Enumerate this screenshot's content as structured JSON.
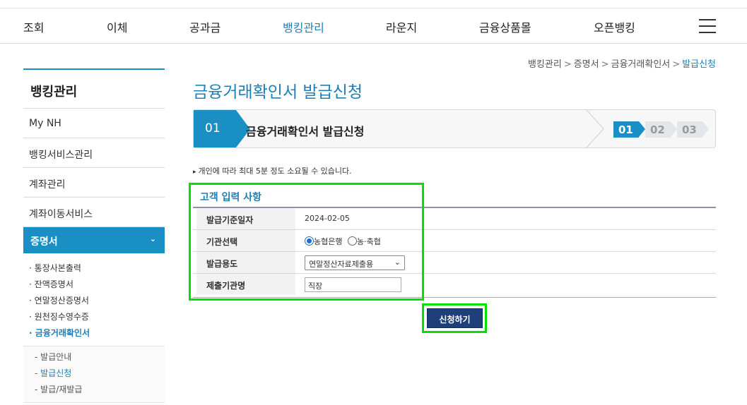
{
  "topnav": {
    "items": [
      "조회",
      "이체",
      "공과금",
      "뱅킹관리",
      "라운지",
      "금융상품몰",
      "오픈뱅킹"
    ],
    "active_index": 3,
    "menu_icon": "hamburger-icon"
  },
  "breadcrumb": [
    "뱅킹관리",
    "증명서",
    "금융거래확인서",
    "발급신청"
  ],
  "breadcrumb_separator": ">",
  "sidebar": {
    "title": "뱅킹관리",
    "menus": [
      "My NH",
      "뱅킹서비스관리",
      "계좌관리",
      "계좌이동서비스"
    ],
    "active_menu": "증명서",
    "sub_items": [
      "통장사본출력",
      "잔액증명서",
      "연말정산증명서",
      "원천징수영수증",
      "금융거래확인서"
    ],
    "sub_bullet": "·",
    "third_items": [
      "발급안내",
      "발급신청",
      "발급/재발급"
    ],
    "third_prefix": "-"
  },
  "page_title": "금융거래확인서 발급신청",
  "steps": {
    "current_number": "01",
    "current_label": "금융거래확인서 발급신청",
    "chips": [
      "01",
      "02",
      "03"
    ],
    "active_chip_index": 0
  },
  "notice": "개인에 따라 최대 5분 정도 소요될 수 있습니다.",
  "form": {
    "section_title": "고객 입력 사항",
    "rows": {
      "base_date_label": "발급기준일자",
      "base_date_value": "2024-02-05",
      "institution_label": "기관선택",
      "institution_options": [
        "농협은행",
        "농·축협"
      ],
      "institution_selected": 0,
      "purpose_label": "발급용도",
      "purpose_value": "연말정산자료제출용",
      "submit_to_label": "제출기관명",
      "submit_to_value": "직장"
    },
    "submit_label": "신청하기"
  },
  "colors": {
    "brand_blue": "#1a8fc4",
    "submit_navy": "#1e3f7a",
    "highlight_green": "#00e000"
  }
}
